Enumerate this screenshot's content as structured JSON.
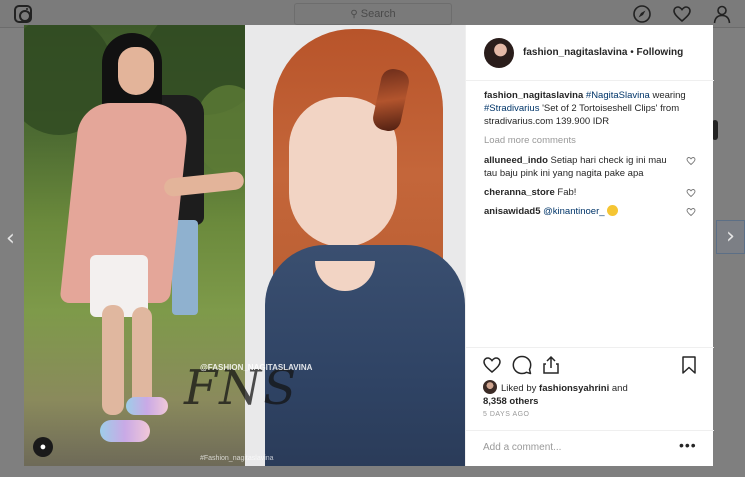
{
  "header": {
    "search_placeholder": "Search",
    "search_icon": "search-icon",
    "icons": [
      "instagram-logo-icon",
      "compass-icon",
      "heart-icon",
      "profile-icon"
    ]
  },
  "nav": {
    "prev_icon": "chevron-left-icon",
    "next_icon": "chevron-right-icon",
    "prev_glyph": "‹",
    "next_glyph": "›"
  },
  "image": {
    "watermark_main": "FNS",
    "watermark_handle": "@FASHION_NAGITASLAVINA",
    "watermark_sub": "#Fashion_nagitaslavina"
  },
  "post": {
    "username": "fashion_nagitaslavina",
    "separator": " • ",
    "follow_status": "Following",
    "caption": {
      "user": "fashion_nagitaslavina",
      "tag1": "#NagitaSlavina",
      "text1": " wearing ",
      "tag2": "#Stradivarius",
      "text2": " 'Set of 2 Tortoiseshell Clips' from stradivarius.com 139.900 IDR"
    },
    "load_more": "Load more comments",
    "comments": [
      {
        "user": "alluneed_indo",
        "text": "Setiap hari check ig ini mau tau baju pink ini yang nagita pake apa"
      },
      {
        "user": "cheranna_store",
        "text": "Fab!"
      },
      {
        "user": "anisawidad5",
        "mention": "@kinantinoer_",
        "text": ""
      }
    ],
    "liked_by_prefix": "Liked by ",
    "liked_by_user": "fashionsyahrini",
    "liked_by_and": " and",
    "likes_count": "8,358 others",
    "timestamp": "5 DAYS AGO",
    "add_comment_placeholder": "Add a comment...",
    "more_glyph": "•••"
  },
  "colors": {
    "accent_link": "#003569",
    "muted": "#999999",
    "overlay": "#7f7f7f"
  }
}
